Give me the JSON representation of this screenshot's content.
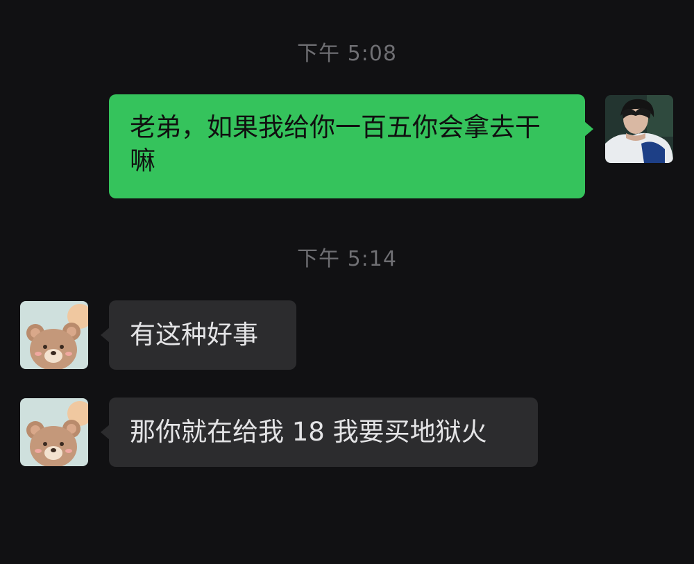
{
  "messages": [
    {
      "type": "timestamp",
      "text": "下午 5:08"
    },
    {
      "type": "outgoing",
      "text": "老弟，如果我给你一百五你会拿去干嘛",
      "avatar": "boy-photo-avatar"
    },
    {
      "type": "timestamp",
      "text": "下午 5:14"
    },
    {
      "type": "incoming",
      "text": "有这种好事",
      "avatar": "bear-avatar"
    },
    {
      "type": "incoming",
      "text": "那你就在给我 18 我要买地狱火",
      "avatar": "bear-avatar"
    }
  ],
  "colors": {
    "background": "#111113",
    "outgoing_bubble": "#35c35c",
    "incoming_bubble": "#2c2c2e",
    "timestamp_text": "#6f6f73"
  }
}
